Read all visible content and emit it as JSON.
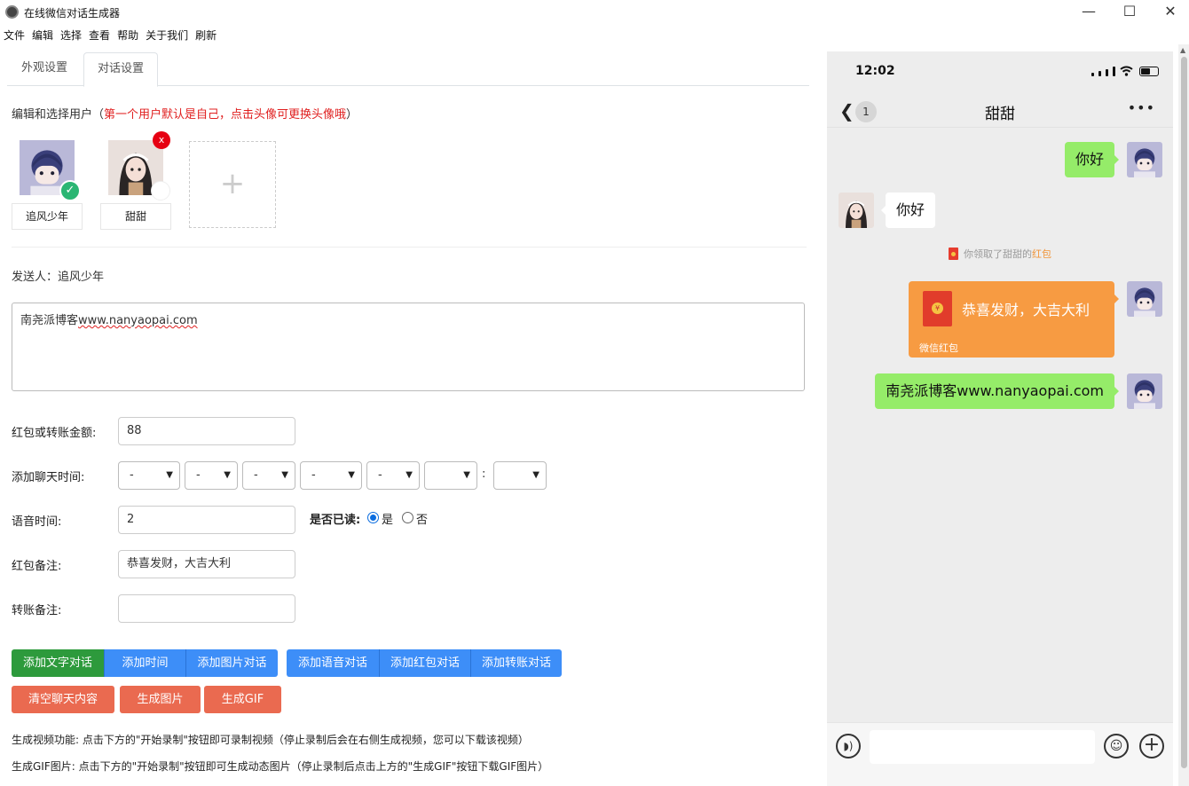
{
  "window": {
    "title": "在线微信对话生成器",
    "min": "—",
    "max": "☐",
    "close": "✕"
  },
  "menu": [
    "文件",
    "编辑",
    "选择",
    "查看",
    "帮助",
    "关于我们",
    "刷新"
  ],
  "tabs": [
    "外观设置",
    "对话设置"
  ],
  "user_section": {
    "hint_prefix": "编辑和选择用户（",
    "hint_red": "第一个用户默认是自己，点击头像可更换头像哦",
    "hint_suffix": "）",
    "users": [
      {
        "name": "追风少年",
        "selected": true
      },
      {
        "name": "甜甜",
        "selected": false
      }
    ],
    "delete_badge": "x",
    "check_badge": "✓",
    "add_user": "+"
  },
  "sender": "发送人：追风少年",
  "message": {
    "prefix": "南尧派博客",
    "link": "www.nanyaopai.com"
  },
  "form": {
    "amount_label": "红包或转账金额:",
    "amount_value": "88",
    "time_label": "添加聊天时间:",
    "time_selects": [
      "-",
      "-",
      "-",
      "-",
      "-",
      "",
      ""
    ],
    "time_colon": ":",
    "voice_label": "语音时间:",
    "voice_value": "2",
    "read_label": "是否已读:",
    "read_yes": "是",
    "read_no": "否",
    "read_selected": "是",
    "rp_note_label": "红包备注:",
    "rp_note_value": "恭喜发财，大吉大利",
    "transfer_note_label": "转账备注:",
    "transfer_note_value": ""
  },
  "buttons": {
    "add_text": "添加文字对话",
    "add_time": "添加时间",
    "add_image": "添加图片对话",
    "add_voice": "添加语音对话",
    "add_redpacket": "添加红包对话",
    "add_transfer": "添加转账对话",
    "clear": "清空聊天内容",
    "gen_image": "生成图片",
    "gen_gif": "生成GIF"
  },
  "notes": {
    "video": "生成视频功能: 点击下方的\"开始录制\"按钮即可录制视频（停止录制后会在右侧生成视频，您可以下载该视频）",
    "gif": "生成GIF图片: 点击下方的\"开始录制\"按钮即可生成动态图片（停止录制后点击上方的\"生成GIF\"按钮下载GIF图片）"
  },
  "phone": {
    "time": "12:02",
    "unread": "1",
    "chat_title": "甜甜",
    "more": "•••",
    "messages": {
      "m1": "你好",
      "m2": "你好",
      "sys_prefix": "你领取了甜甜的",
      "sys_link": "红包",
      "rp_text": "恭喜发财，大吉大利",
      "rp_label": "微信红包",
      "m4": "南尧派博客www.nanyaopai.com"
    }
  },
  "colors": {
    "accent_blue": "#3d8ef8",
    "green_button": "#2d9a3c",
    "red_button": "#ea6a50",
    "bubble_green": "#95ec69",
    "redpacket_orange": "#f79b42",
    "hint_red": "#e02020"
  }
}
